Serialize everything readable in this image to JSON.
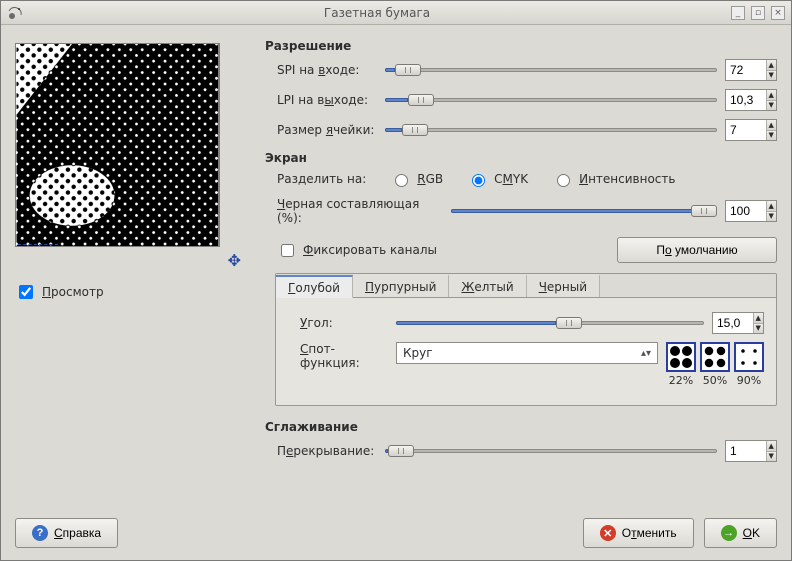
{
  "title": "Газетная бумага",
  "preview": {
    "checkbox": "Просмотр",
    "checked": true,
    "move_icon": "move-icon"
  },
  "resolution": {
    "heading": "Разрешение",
    "spi": {
      "label": "SPI на входе:",
      "value": "72",
      "pos": 3
    },
    "lpi": {
      "label": "LPI на выходе:",
      "value": "10,3",
      "pos": 7
    },
    "cell": {
      "label": "Размер ячейки:",
      "value": "7",
      "pos": 5
    }
  },
  "screen": {
    "heading": "Экран",
    "split_label": "Разделить на:",
    "options": {
      "rgb": "RGB",
      "cmyk": "CMYK",
      "intensity": "Интенсивность",
      "selected": "cmyk"
    },
    "black": {
      "label": "Черная составляющая (%):",
      "value": "100",
      "pos": 100
    },
    "lock": {
      "label": "Фиксировать каналы",
      "checked": false
    },
    "reset": "По умолчанию",
    "tabs": {
      "cyan": "Голубой",
      "magenta": "Пурпурный",
      "yellow": "Желтый",
      "black": "Черный",
      "active": "cyan"
    },
    "angle": {
      "label": "Угол:",
      "value": "15,0",
      "pos": 52
    },
    "spot": {
      "label": "Спот-функция:",
      "value": "Круг"
    },
    "swatches": [
      "22%",
      "50%",
      "90%"
    ]
  },
  "antialias": {
    "heading": "Сглаживание",
    "overlap": {
      "label": "Перекрывание:",
      "value": "1",
      "pos": 1
    }
  },
  "buttons": {
    "help": "Справка",
    "cancel": "Отменить",
    "ok": "OK"
  }
}
